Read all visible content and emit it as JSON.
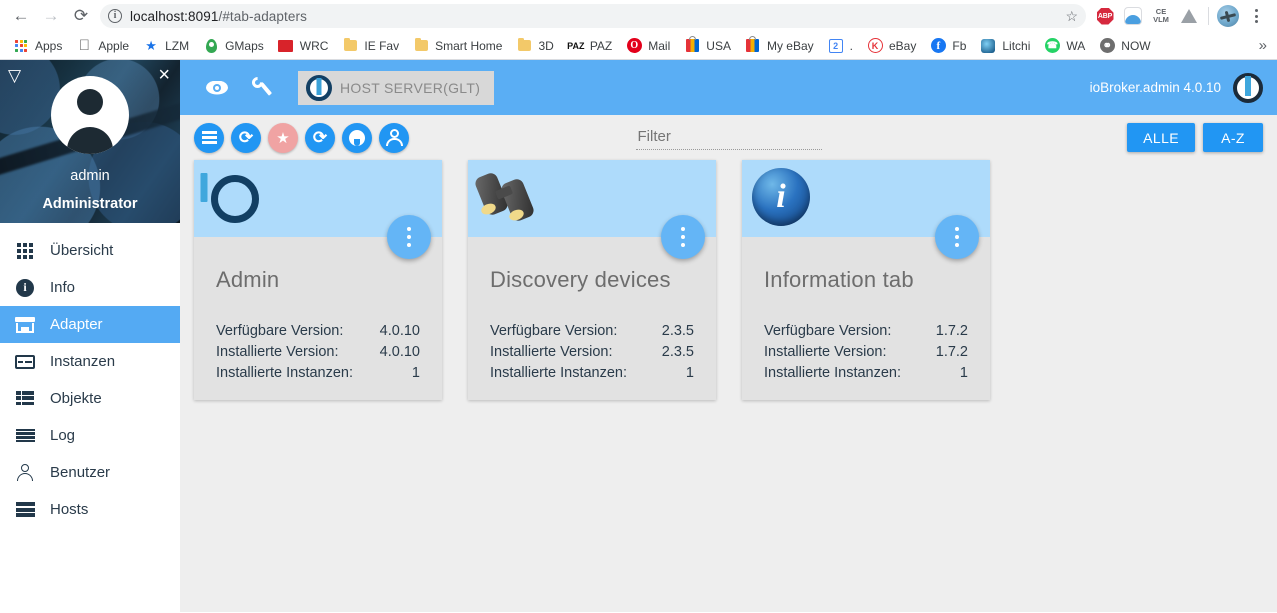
{
  "browser": {
    "back_icon": "back-arrow-icon",
    "forward_icon": "forward-arrow-icon",
    "reload_icon": "reload-icon",
    "url_host": "localhost:8091",
    "url_path": "/#tab-adapters",
    "url_full": "localhost:8091/#tab-adapters",
    "star_glyph": "☆",
    "extensions": [
      {
        "name": "abp-extension-icon",
        "label": "ABP"
      },
      {
        "name": "cloud-extension-icon",
        "label": ""
      },
      {
        "name": "ce-vlm-extension-icon",
        "label": "CE VLM",
        "line1": "CE",
        "line2": "VLM"
      },
      {
        "name": "drive-extension-icon",
        "label": ""
      },
      {
        "name": "profile-avatar",
        "label": ""
      }
    ],
    "menu_icon": "chrome-menu-icon",
    "bookmarks": [
      {
        "label": "Apps",
        "icon": "apps-grid-icon"
      },
      {
        "label": "Apple",
        "icon": "apple-logo-icon",
        "glyph": ""
      },
      {
        "label": "LZM",
        "icon": "star-icon",
        "glyph": "★",
        "color": "#1a73e8"
      },
      {
        "label": "GMaps",
        "icon": "google-maps-pin-icon",
        "glyph": "●",
        "color": "#34a853"
      },
      {
        "label": "WRC",
        "icon": "wrc-favicon"
      },
      {
        "label": "IE Fav",
        "icon": "folder-icon"
      },
      {
        "label": "Smart Home",
        "icon": "folder-icon"
      },
      {
        "label": "3D",
        "icon": "folder-icon"
      },
      {
        "label": "PAZ",
        "icon": "paz-text-icon",
        "glyph": "PAZ"
      },
      {
        "label": "Mail",
        "icon": "opera-mail-icon",
        "glyph": "O",
        "color": "#e3001b"
      },
      {
        "label": "USA",
        "icon": "shopping-bag-icon"
      },
      {
        "label": "My eBay",
        "icon": "shopping-bag-icon"
      },
      {
        "label": ".",
        "icon": "calendar-icon",
        "glyph": "2",
        "color": "#4285f4"
      },
      {
        "label": "eBay",
        "icon": "ebay-k-icon",
        "glyph": "K",
        "color": "#e53238"
      },
      {
        "label": "Fb",
        "icon": "facebook-icon",
        "glyph": "f",
        "color": "#1877f2"
      },
      {
        "label": "Litchi",
        "icon": "litchi-icon"
      },
      {
        "label": "WA",
        "icon": "whatsapp-icon",
        "glyph": "✆",
        "color": "#25d366"
      },
      {
        "label": "NOW",
        "icon": "now-globe-icon",
        "glyph": "◔",
        "color": "#6e6e6e"
      }
    ],
    "bookmarks_overflow_glyph": "»"
  },
  "sidebar": {
    "collapse_icon": "collapse-triangle-icon",
    "collapse_glyph": "▽",
    "close_icon": "close-icon",
    "close_glyph": "×",
    "avatar_icon": "user-avatar-icon",
    "username": "admin",
    "role": "Administrator",
    "items": [
      {
        "label": "Übersicht",
        "icon": "overview-grid-icon",
        "active": false
      },
      {
        "label": "Info",
        "icon": "info-icon",
        "active": false
      },
      {
        "label": "Adapter",
        "icon": "adapter-store-icon",
        "active": true
      },
      {
        "label": "Instanzen",
        "icon": "instances-icon",
        "active": false
      },
      {
        "label": "Objekte",
        "icon": "objects-list-icon",
        "active": false
      },
      {
        "label": "Log",
        "icon": "log-lines-icon",
        "active": false
      },
      {
        "label": "Benutzer",
        "icon": "users-person-icon",
        "active": false
      },
      {
        "label": "Hosts",
        "icon": "hosts-server-icon",
        "active": false
      }
    ]
  },
  "appbar": {
    "eye_icon": "eye-icon",
    "wrench_icon": "wrench-icon",
    "host_chip_label": "HOST SERVER(GLT)",
    "host_chip_icon": "iobroker-logo-icon",
    "version_label": "ioBroker.admin 4.0.10",
    "logo_icon": "iobroker-logo-icon",
    "background_color": "#5aaef4"
  },
  "toolbar": {
    "buttons": [
      {
        "name": "category-list-button",
        "icon": "list-icon",
        "color": "#2196f3"
      },
      {
        "name": "refresh-button",
        "icon": "refresh-icon",
        "color": "#2196f3"
      },
      {
        "name": "favorites-button",
        "icon": "star-icon",
        "color": "#f0a3a3"
      },
      {
        "name": "check-updates-button",
        "icon": "update-clock-icon",
        "color": "#2196f3"
      },
      {
        "name": "github-install-button",
        "icon": "github-icon",
        "color": "#2196f3"
      },
      {
        "name": "developer-adapters-button",
        "icon": "developer-person-icon",
        "color": "#2196f3"
      }
    ],
    "filter_placeholder": "Filter",
    "filter_value": "",
    "all_button": "ALLE",
    "sort_button": "A-Z"
  },
  "cards": [
    {
      "title": "Admin",
      "icon": "iobroker-admin-gear-icon",
      "menu_icon": "more-vertical-icon",
      "rows": [
        {
          "label": "Verfügbare Version:",
          "value": "4.0.10"
        },
        {
          "label": "Installierte Version:",
          "value": "4.0.10"
        },
        {
          "label": "Installierte Instanzen:",
          "value": "1"
        }
      ]
    },
    {
      "title": "Discovery devices",
      "icon": "binoculars-icon",
      "menu_icon": "more-vertical-icon",
      "rows": [
        {
          "label": "Verfügbare Version:",
          "value": "2.3.5"
        },
        {
          "label": "Installierte Version:",
          "value": "2.3.5"
        },
        {
          "label": "Installierte Instanzen:",
          "value": "1"
        }
      ]
    },
    {
      "title": "Information tab",
      "icon": "info-blue-icon",
      "menu_icon": "more-vertical-icon",
      "rows": [
        {
          "label": "Verfügbare Version:",
          "value": "1.7.2"
        },
        {
          "label": "Installierte Version:",
          "value": "1.7.2"
        },
        {
          "label": "Installierte Instanzen:",
          "value": "1"
        }
      ]
    }
  ]
}
